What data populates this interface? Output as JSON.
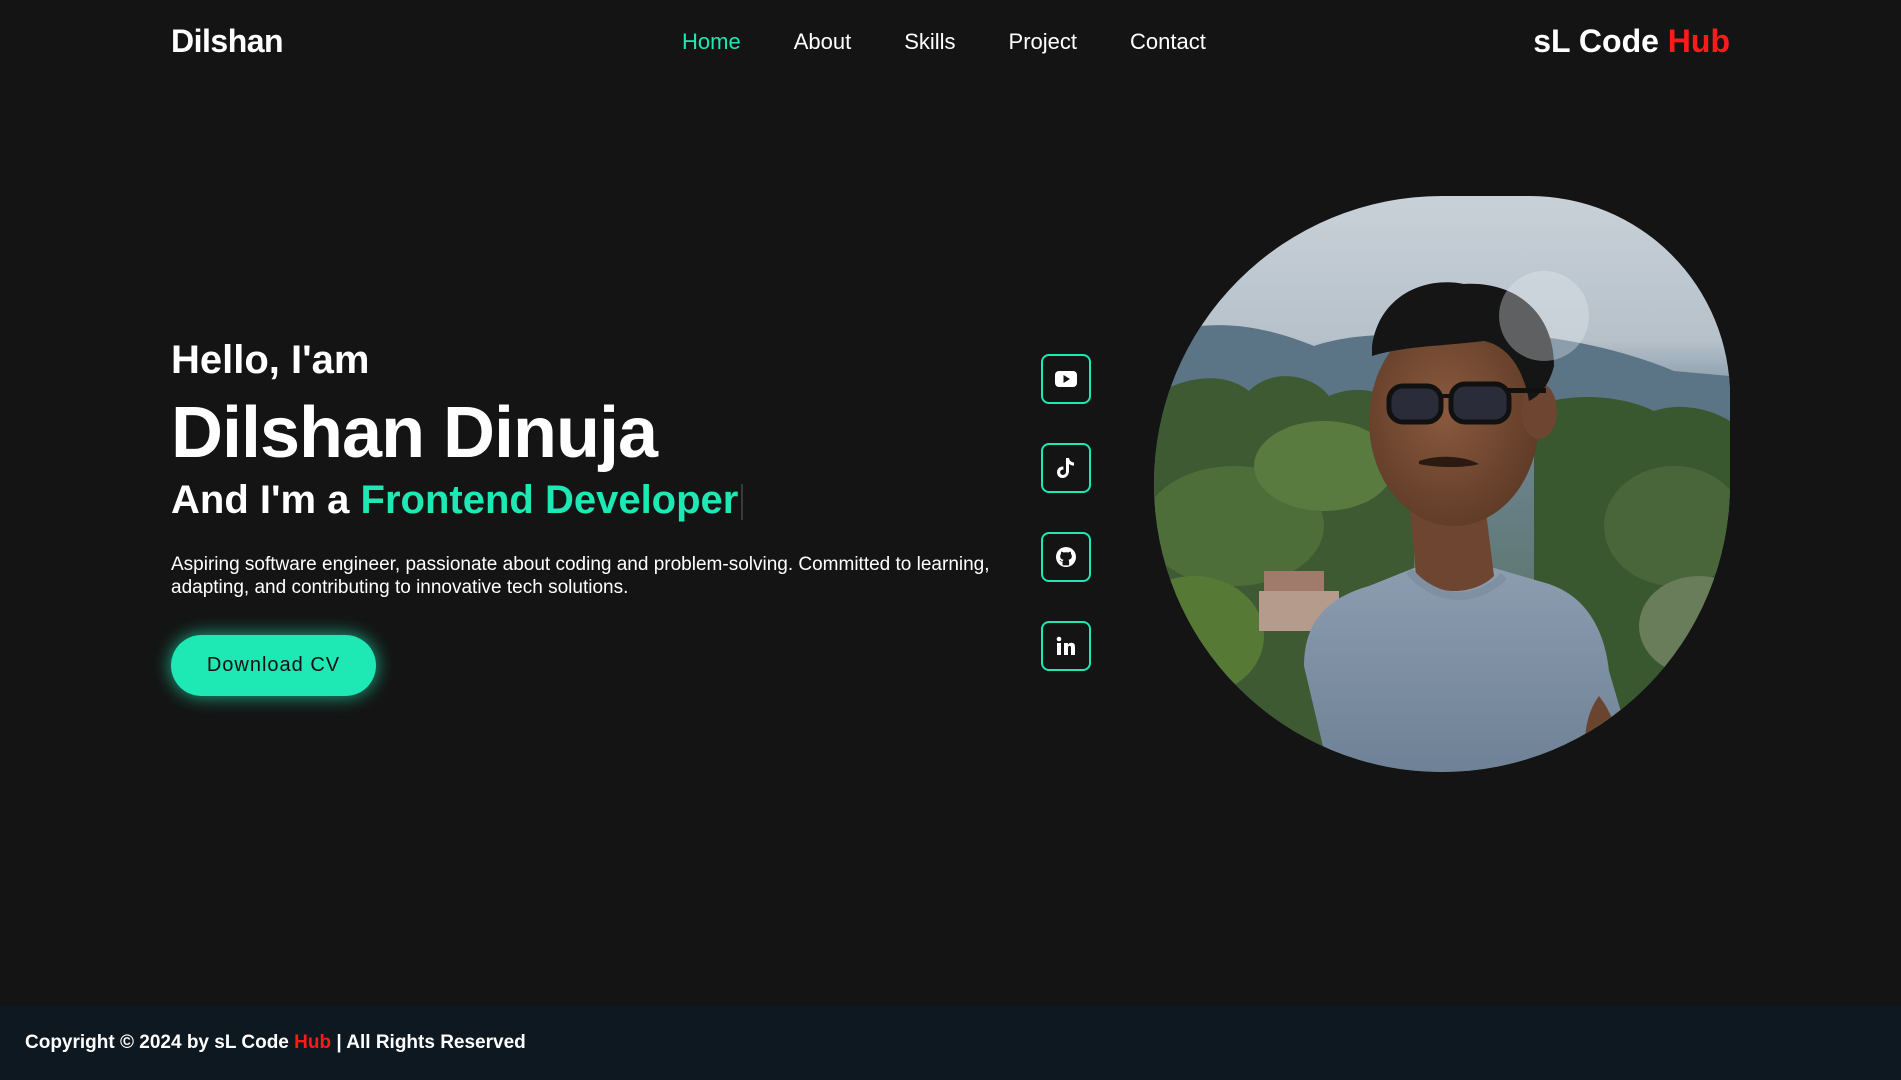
{
  "header": {
    "logo": "Dilshan",
    "nav": [
      {
        "label": "Home",
        "active": true
      },
      {
        "label": "About",
        "active": false
      },
      {
        "label": "Skills",
        "active": false
      },
      {
        "label": "Project",
        "active": false
      },
      {
        "label": "Contact",
        "active": false
      }
    ],
    "brand_main": "sL Code ",
    "brand_accent": "Hub"
  },
  "hero": {
    "greeting": "Hello, I'am",
    "name": "Dilshan Dinuja",
    "role_prefix": "And I'm a ",
    "role": "Frontend Developer",
    "bio": "Aspiring software engineer, passionate about coding and problem-solving. Committed to learning, adapting, and contributing to innovative tech solutions.",
    "cv_button": "Download CV"
  },
  "socials": [
    {
      "icon": "youtube-icon"
    },
    {
      "icon": "tiktok-icon"
    },
    {
      "icon": "github-icon"
    },
    {
      "icon": "linkedin-icon"
    }
  ],
  "footer": {
    "prefix": "Copyright © 2024 by sL Code ",
    "accent": "Hub",
    "suffix": " | All Rights Reserved"
  },
  "colors": {
    "background": "#141414",
    "accent": "#1ee8b3",
    "brand_red": "#ff1a1a",
    "footer_bg": "#0d1820"
  }
}
